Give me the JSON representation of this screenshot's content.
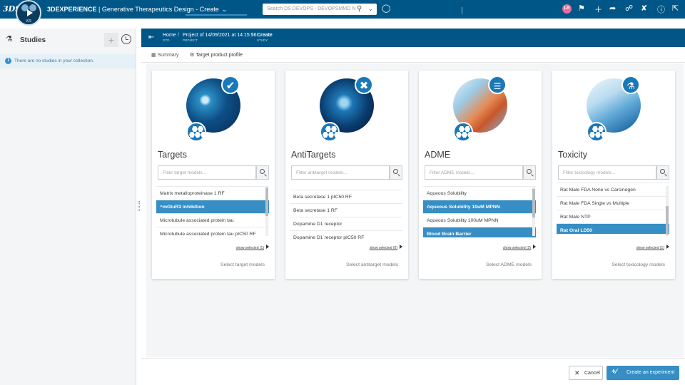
{
  "topbar": {
    "brand_logo": "3DS",
    "brand_bold": "3DEXPERIENCE",
    "brand_sep": " | ",
    "app_title": "Generative Therapeutics Design - Create",
    "compass_label": "V,R",
    "search_placeholder": "Search DS DEVOPS - DEVOPSMMO N...",
    "avatar_initials": "LR"
  },
  "left_panel": {
    "title": "Studies",
    "info_text": "There are no studies in your collection."
  },
  "breadcrumb": [
    {
      "label": "Home",
      "sub": "GTD"
    },
    {
      "label": "Project of 14/09/2021 at 14:15:56",
      "sub": "PROJECT"
    },
    {
      "label": "Create",
      "sub": "STUDY"
    }
  ],
  "tabs": [
    {
      "label": "Summary",
      "icon": "bar-chart-icon"
    },
    {
      "label": "Target product profile",
      "icon": "adjust-icon"
    }
  ],
  "cards": [
    {
      "title": "Targets",
      "badge_icon": "check-icon",
      "filter_placeholder": "Filter target models...",
      "items": [
        {
          "label": "Matrix metalloproteinase 1 RF",
          "selected": false
        },
        {
          "label": "^mGluR3 inhibition",
          "selected": true
        },
        {
          "label": "Microtubule associated protein tau",
          "selected": false
        },
        {
          "label": "Microtubule associated protein tau pIC50 RF",
          "selected": false
        }
      ],
      "show_selected": "show selected (1)",
      "select_link": "Select target models"
    },
    {
      "title": "AntiTargets",
      "badge_icon": "cross-icon",
      "filter_placeholder": "Filter antitarget models...",
      "items": [
        {
          "label": "Beta secretase 1 pIC50 RF",
          "selected": false
        },
        {
          "label": "Beta secretase 1 RF",
          "selected": false
        },
        {
          "label": "Dopamine D1 receptor",
          "selected": false
        },
        {
          "label": "Dopamine D1 receptor pIC50 RF",
          "selected": false
        }
      ],
      "show_selected": "show selected (0)",
      "select_link": "Select antitarget models"
    },
    {
      "title": "ADME",
      "badge_icon": "sliders-icon",
      "filter_placeholder": "Filter ADME models...",
      "items": [
        {
          "label": "Aqueous Solubility",
          "selected": false
        },
        {
          "label": "Aqueous Solubility 10uM MPNN",
          "selected": true
        },
        {
          "label": "Aqueous Solubility 100uM MPNN",
          "selected": false
        },
        {
          "label": "Blood Brain Barrier",
          "selected": true
        }
      ],
      "show_selected": "show selected (2)",
      "select_link": "Select ADME models"
    },
    {
      "title": "Toxicity",
      "badge_icon": "flask-icon",
      "filter_placeholder": "Filter toxicology models...",
      "items": [
        {
          "label": "Rat Male FDA None vs Carcinogen",
          "selected": false
        },
        {
          "label": "Rat Male FDA Single vs Multiple",
          "selected": false
        },
        {
          "label": "Rat Male NTP",
          "selected": false
        },
        {
          "label": "Rat Oral LD50",
          "selected": true
        }
      ],
      "show_selected": "show selected (1)",
      "select_link": "Select toxicology models"
    }
  ],
  "footer": {
    "cancel_label": "Cancel",
    "create_label": "Create an experiment"
  },
  "colors": {
    "header_blue": "#005686",
    "accent_blue": "#368ec4",
    "badge_blue": "#1b78b8"
  }
}
